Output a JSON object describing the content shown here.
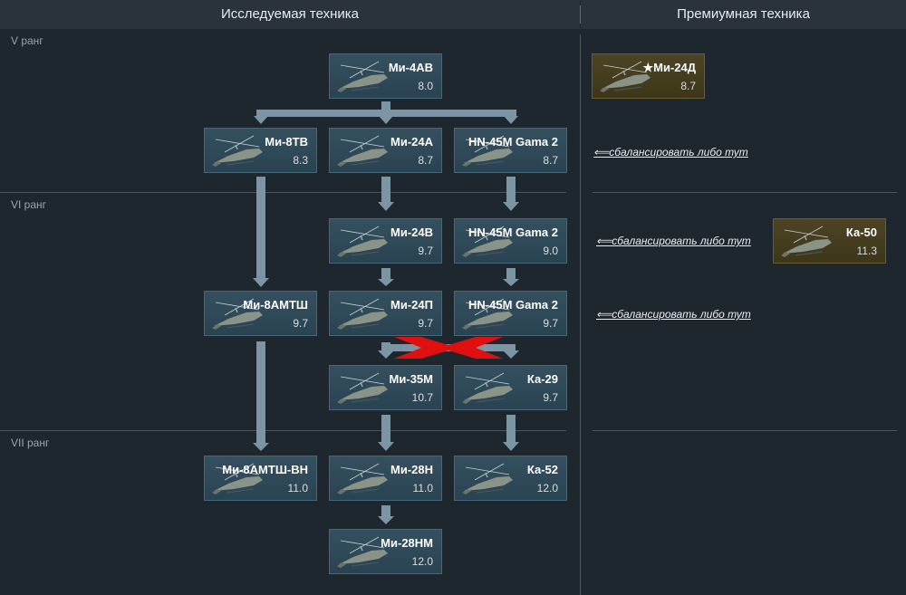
{
  "header": {
    "left_title": "Исследуемая техника",
    "right_title": "Премиумная техника"
  },
  "ranks": {
    "v": "V ранг",
    "vi": "VI ранг",
    "vii": "VII ранг"
  },
  "colors": {
    "background": "#1e262e",
    "card_researchable": "#2f4858",
    "card_premium": "#453d1f",
    "arrow": "#7b95a4",
    "cross": "#e01010"
  },
  "vehicles": {
    "mi4av": {
      "name": "Ми-4АВ",
      "br": "8.0",
      "icon": "helicopter-icon"
    },
    "mi8tv": {
      "name": "Ми-8ТВ",
      "br": "8.3",
      "icon": "helicopter-icon"
    },
    "mi24a": {
      "name": "Ми-24А",
      "br": "8.7",
      "icon": "helicopter-icon"
    },
    "hn45m_1": {
      "name": "HN-45M Gama 2",
      "br": "8.7",
      "icon": "helicopter-icon"
    },
    "mi24v": {
      "name": "Ми-24В",
      "br": "9.7",
      "icon": "helicopter-icon"
    },
    "hn45m_2": {
      "name": "HN-45M Gama 2",
      "br": "9.0",
      "icon": "helicopter-icon"
    },
    "mi8amtsh": {
      "name": "Ми-8АМТШ",
      "br": "9.7",
      "icon": "helicopter-icon"
    },
    "mi24p": {
      "name": "Ми-24П",
      "br": "9.7",
      "icon": "helicopter-icon"
    },
    "hn45m_3": {
      "name": "HN-45M Gama 2",
      "br": "9.7",
      "icon": "helicopter-icon"
    },
    "mi35m": {
      "name": "Ми-35М",
      "br": "10.7",
      "icon": "helicopter-icon"
    },
    "ka29": {
      "name": "Ка-29",
      "br": "9.7",
      "icon": "helicopter-icon"
    },
    "mi8amtshvn": {
      "name": "Ми-8АМТШ-ВН",
      "br": "11.0",
      "icon": "helicopter-icon"
    },
    "mi28n": {
      "name": "Ми-28Н",
      "br": "11.0",
      "icon": "helicopter-icon"
    },
    "ka52": {
      "name": "Ка-52",
      "br": "12.0",
      "icon": "helicopter-icon"
    },
    "mi28nm": {
      "name": "Ми-28НМ",
      "br": "12.0",
      "icon": "helicopter-icon"
    }
  },
  "premium": {
    "mi24d": {
      "name": "★Ми-24Д",
      "br": "8.7",
      "icon": "helicopter-icon"
    },
    "ka50": {
      "name": "Ка-50",
      "br": "11.3",
      "icon": "helicopter-icon"
    }
  },
  "balance_links": {
    "text": "⟸сбалансировать либо тут"
  }
}
